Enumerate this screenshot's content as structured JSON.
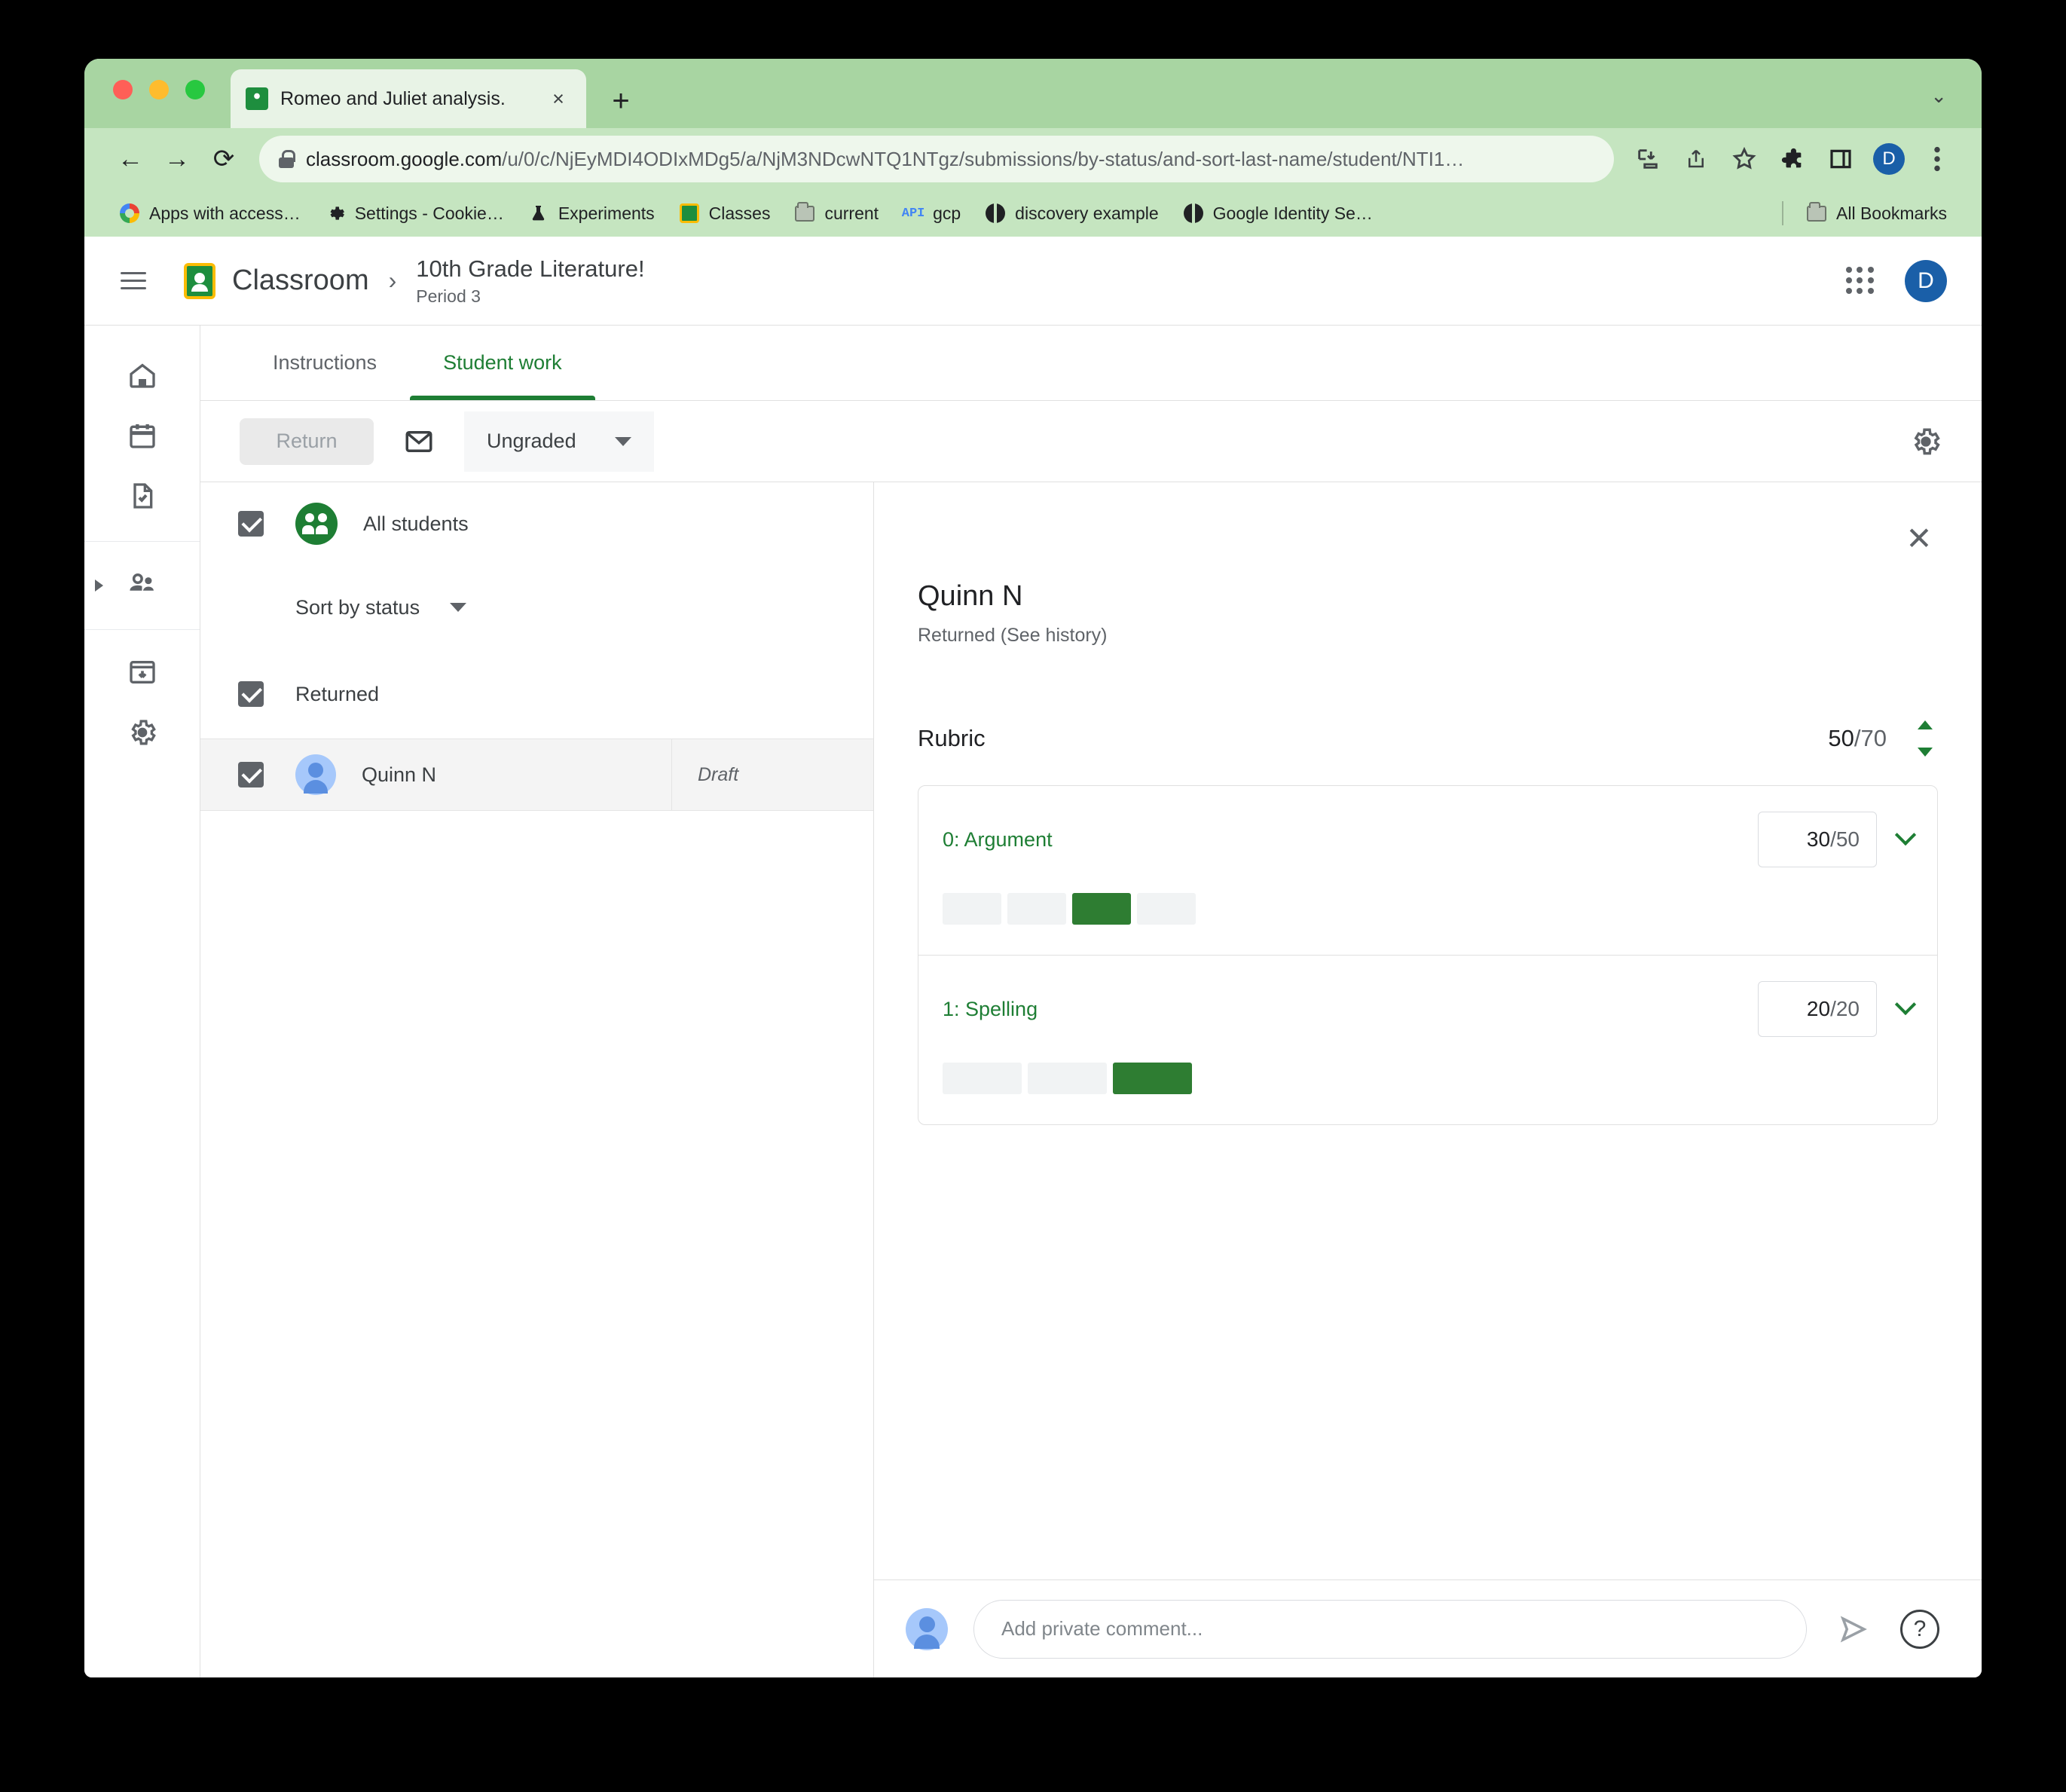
{
  "browser": {
    "tab": {
      "title": "Romeo and Juliet analysis.",
      "favicon": "classroom-icon",
      "close": "×"
    },
    "new_tab": "+",
    "window_chevron": "⌄",
    "nav": {
      "back": "←",
      "forward": "→",
      "reload": "⟳"
    },
    "omnibox": {
      "lock": "lock-icon",
      "url_domain": "classroom.google.com",
      "url_path": "/u/0/c/NjEyMDI4ODIxMDg5/a/NjM3NDcwNTQ1NTgz/submissions/by-status/and-sort-last-name/student/NTI1…"
    },
    "toolbar_icons": [
      "download-icon",
      "share-icon",
      "bookmark-star-icon",
      "extensions-icon",
      "side-panel-icon",
      "profile-avatar",
      "more-menu-icon"
    ],
    "profile_initial": "D",
    "bookmarks": [
      {
        "label": "Apps with access…",
        "icon": "google-icon"
      },
      {
        "label": "Settings - Cookie…",
        "icon": "gear-icon"
      },
      {
        "label": "Experiments",
        "icon": "flask-icon"
      },
      {
        "label": "Classes",
        "icon": "classroom-icon"
      },
      {
        "label": "current",
        "icon": "folder-icon"
      },
      {
        "label": "gcp",
        "icon": "api-icon"
      },
      {
        "label": "discovery example",
        "icon": "globe-icon"
      },
      {
        "label": "Google Identity Se…",
        "icon": "globe-icon"
      }
    ],
    "all_bookmarks": {
      "label": "All Bookmarks",
      "icon": "folder-icon"
    }
  },
  "app": {
    "menu_icon": "hamburger-icon",
    "logo_text": "Classroom",
    "breadcrumb_separator": "›",
    "class_title": "10th Grade Literature!",
    "class_section": "Period 3",
    "apps_grid": "apps-grid-icon",
    "account_initial": "D"
  },
  "rail": {
    "items": [
      {
        "name": "home",
        "icon": "home-icon"
      },
      {
        "name": "calendar",
        "icon": "calendar-icon"
      },
      {
        "name": "to-review",
        "icon": "document-check-icon"
      },
      {
        "name": "enrolled",
        "icon": "people-icon",
        "expandable": true
      },
      {
        "name": "archived",
        "icon": "archive-icon"
      },
      {
        "name": "settings",
        "icon": "gear-icon"
      }
    ]
  },
  "tabs": [
    {
      "label": "Instructions",
      "selected": false
    },
    {
      "label": "Student work",
      "selected": true
    }
  ],
  "toolbar": {
    "return_label": "Return",
    "email_icon": "envelope-icon",
    "filter_value": "Ungraded",
    "settings_icon": "gear-icon"
  },
  "student_list": {
    "all_students_label": "All students",
    "all_students_checked": true,
    "sort_label": "Sort by status",
    "groups": [
      {
        "label": "Returned",
        "checked": true,
        "students": [
          {
            "name": "Quinn N",
            "status": "Draft",
            "checked": true,
            "selected": true
          }
        ]
      }
    ]
  },
  "detail": {
    "close_icon": "close-icon",
    "student_name": "Quinn N",
    "status_line": "Returned (See history)",
    "rubric": {
      "label": "Rubric",
      "score": "50",
      "score_total": "/70",
      "stepper_icon": "stepper-updown-icon",
      "criteria": [
        {
          "name": "0: Argument",
          "points": "30",
          "points_total": "/50",
          "chevron": "chevron-down-icon",
          "levels": 4,
          "selected_level": 3,
          "seg_widths": [
            78,
            78,
            78,
            78
          ]
        },
        {
          "name": "1: Spelling",
          "points": "20",
          "points_total": "/20",
          "chevron": "chevron-down-icon",
          "levels": 3,
          "selected_level": 3,
          "seg_widths": [
            105,
            105,
            105
          ]
        }
      ]
    },
    "comment": {
      "placeholder": "Add private comment...",
      "send_icon": "send-icon",
      "help_icon": "help-icon",
      "avatar": "user-avatar"
    },
    "accent_color": "#1e7e34",
    "bar_color": "#2e7d32"
  }
}
